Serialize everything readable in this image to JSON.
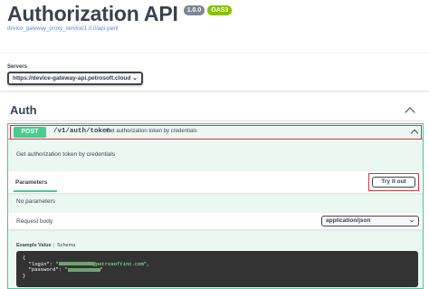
{
  "info": {
    "title": "Authorization API",
    "version_badge": "1.0.0",
    "oas_badge": "OAS3",
    "spec_link": "device_gateway_proxy_service/1.0.0/api.yaml"
  },
  "servers": {
    "label": "Servers",
    "selected": "https://device-gateway-api.petrosoft.cloud",
    "chevron": "⌄"
  },
  "tag": {
    "name": "Auth"
  },
  "operation": {
    "method": "POST",
    "path": "/v1/auth/token",
    "summary": "Get authorization token by credentials",
    "description": "Get authorization token by credentials",
    "parameters_tab": "Parameters",
    "try_it_out": "Try it out",
    "no_parameters": "No parameters",
    "request_body_label": "Request body",
    "content_type": "application/json",
    "example_value_tab": "Example Value",
    "schema_tab": "Schema",
    "code": {
      "open_brace": "{",
      "login_key": "\"login\": ",
      "login_value_suffix": "@petrosoftinc.com\",",
      "password_key": "\"password\": ",
      "close_brace": "}"
    }
  },
  "colors": {
    "post": "#49cc90",
    "highlight": "#d9363e",
    "text": "#3b4151",
    "link": "#4990e2"
  }
}
